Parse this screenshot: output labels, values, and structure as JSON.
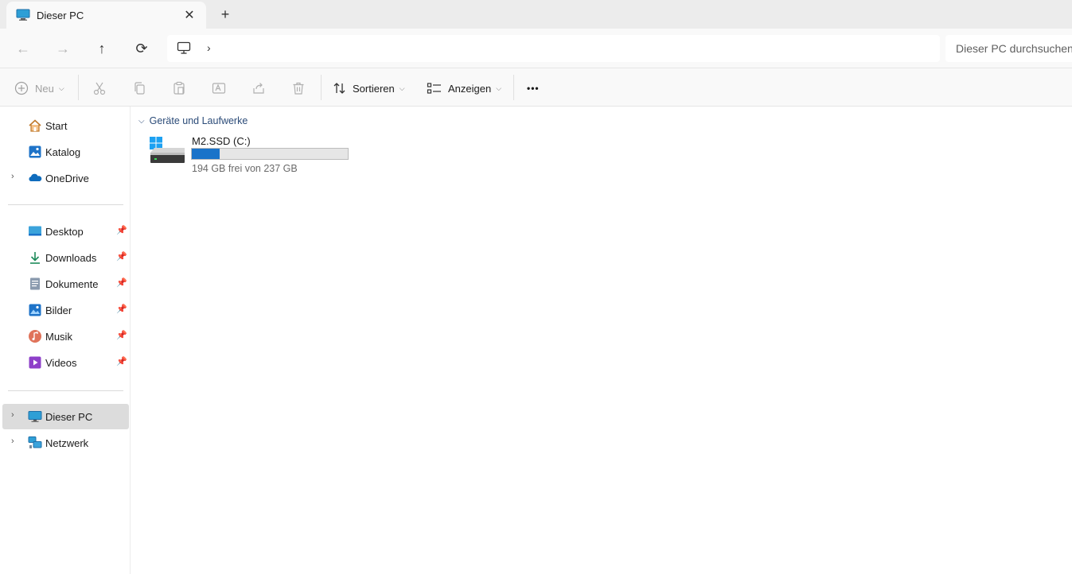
{
  "tab": {
    "title": "Dieser PC",
    "close": "✕",
    "new_tab": "+"
  },
  "nav": {
    "back": "←",
    "forward": "→",
    "up": "↑",
    "refresh": "⟳",
    "breadcrumb_chevron": "›"
  },
  "search": {
    "placeholder": "Dieser PC durchsuchen"
  },
  "toolbar": {
    "new_label": "Neu",
    "sort_label": "Sortieren",
    "view_label": "Anzeigen",
    "more_label": "•••"
  },
  "sidebar": {
    "quick": [
      {
        "label": "Start",
        "icon": "home-icon"
      },
      {
        "label": "Katalog",
        "icon": "gallery-icon"
      },
      {
        "label": "OneDrive",
        "icon": "onedrive-icon"
      }
    ],
    "pinned": [
      {
        "label": "Desktop",
        "icon": "desktop-icon"
      },
      {
        "label": "Downloads",
        "icon": "downloads-icon"
      },
      {
        "label": "Dokumente",
        "icon": "documents-icon"
      },
      {
        "label": "Bilder",
        "icon": "pictures-icon"
      },
      {
        "label": "Musik",
        "icon": "music-icon"
      },
      {
        "label": "Videos",
        "icon": "videos-icon"
      }
    ],
    "locations": [
      {
        "label": "Dieser PC",
        "icon": "this-pc-icon"
      },
      {
        "label": "Netzwerk",
        "icon": "network-icon"
      }
    ]
  },
  "content": {
    "group_title": "Geräte und Laufwerke",
    "drive": {
      "name": "M2.SSD (C:)",
      "free_text": "194 GB frei von 237 GB",
      "used_fraction": 0.18
    }
  },
  "colors": {
    "accent": "#1a73c9",
    "selected_bg": "#dcdcdc",
    "group_header": "#2b4b78"
  }
}
